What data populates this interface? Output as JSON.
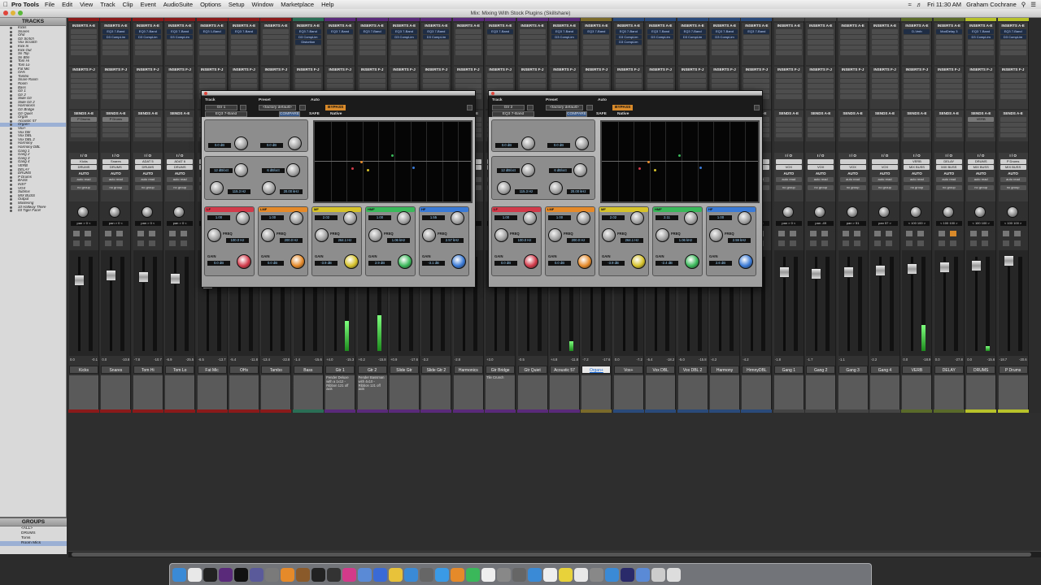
{
  "menubar": {
    "app": "Pro Tools",
    "items": [
      "File",
      "Edit",
      "View",
      "Track",
      "Clip",
      "Event",
      "AudioSuite",
      "Options",
      "Setup",
      "Window",
      "Marketplace",
      "Help"
    ],
    "time": "Fri 11:30 AM",
    "user": "Graham Cochrane"
  },
  "window": {
    "title": "Mix: Mixing With Stock Plugins (Skillshare)"
  },
  "tracks_panel": {
    "title": "TRACKS",
    "items": [
      "Kicks",
      "Snares",
      "Ohd",
      "Gtr Scrtch",
      "Vox Scratch",
      "Kick In",
      "Kick Out",
      "Sn Top",
      "Sn Btm",
      "Tom Hi",
      "Tom Lo",
      "Fat Mic",
      "OHs",
      "Tambo",
      "Snare Room",
      "Room",
      "Bass",
      "Gtr 1",
      "Gtr 2",
      "Slide Gtr",
      "Slide Gtr 2",
      "Harmonics",
      "Gtr Bridge",
      "Gtr Quiet",
      "Organ",
      "Acoustic 57",
      "Organ+",
      "Vox+",
      "Vox Dbl",
      "Vox DBL",
      "Vox DBL 2",
      "Harmony",
      "Harmony DBL",
      "Gang 1",
      "Gang 2",
      "Gang 3",
      "Gang 4",
      "VERB",
      "DELAY",
      "DRUMS",
      "P Drums",
      "BASS",
      "INST",
      "VOX",
      "Submix",
      "MIX BUSS",
      "Output",
      "Mastering",
      "10 Halfway There",
      "03 Tiger Face!"
    ],
    "selected": "Organ+"
  },
  "groups_panel": {
    "title": "GROUPS",
    "items": [
      "<ALL>",
      "DRUMS",
      "Toms",
      "Room Mics"
    ],
    "selected": "Room Mics"
  },
  "strip_labels": {
    "inserts_ae": "INSERTS A-E",
    "inserts_fj": "INSERTS F-J",
    "sends": "SENDS A-E",
    "io": "I / O",
    "auto": "AUTO",
    "group": "no group",
    "auto_mode": "auto read"
  },
  "strips": [
    {
      "name": "Kicks",
      "ins": [],
      "send": "P Drums",
      "out": "DRUMS",
      "in": "Kicks",
      "pan": "pan  > 0 <",
      "vol": [
        "0.0",
        "-0.1"
      ],
      "color": "#8a1a1a",
      "comment": ""
    },
    {
      "name": "Snares",
      "ins": [
        "EQ3 7-Band",
        "D3 CompLim"
      ],
      "send": "P Drums",
      "out": "DRUMS",
      "in": "Snares",
      "pan": "pan  > 0 <",
      "vol": [
        "0.0",
        "-10.8"
      ],
      "color": "#8a1a1a",
      "comment": ""
    },
    {
      "name": "Tom Hi",
      "ins": [
        "EQ3 7-Band",
        "D3 CompLim"
      ],
      "send": "",
      "out": "DRUMS",
      "in": "ADAT 5",
      "pan": "pan  > 0 <",
      "vol": [
        "-7.8",
        "-10.7"
      ],
      "color": "#8a1a1a",
      "comment": ""
    },
    {
      "name": "Tom Lo",
      "ins": [
        "EQ3 7-Band",
        "D3 CompLim"
      ],
      "send": "",
      "out": "DRUMS",
      "in": "ADAT 6",
      "pan": "pan  > 0 <",
      "vol": [
        "-6.9",
        "-25.5"
      ],
      "color": "#8a1a1a",
      "comment": ""
    },
    {
      "name": "Fat Mic",
      "ins": [
        "EQ3 1-Band"
      ],
      "send": "",
      "out": "DRUMS",
      "in": "ADAT 7",
      "pan": "pan  > 0 <",
      "vol": [
        "-6.5",
        "-13.7"
      ],
      "color": "#8a1a1a",
      "comment": ""
    },
    {
      "name": "OHs",
      "ins": [
        "EQ3 7-Band"
      ],
      "send": "",
      "out": "DRUMS",
      "in": "",
      "pan": "pan  > 0 <",
      "vol": [
        "-5.4",
        "-11.8"
      ],
      "color": "#8a1a1a",
      "comment": ""
    },
    {
      "name": "Tambo",
      "ins": [],
      "send": "",
      "out": "DRUMS",
      "in": "",
      "pan": "pan  > 0 <",
      "vol": [
        "-13.4",
        "-22.8"
      ],
      "color": "#8a1a1a",
      "comment": ""
    },
    {
      "name": "Bass",
      "ins": [
        "EQ3 7-Band",
        "D3 CompLim",
        "Distortion"
      ],
      "send": "",
      "out": "BASS",
      "in": "",
      "pan": "pan  > 0 <",
      "vol": [
        "-1.4",
        "-15.6"
      ],
      "color": "#2a6e55",
      "comment": ""
    },
    {
      "name": "Gtr 1",
      "ins": [
        "EQ3 7-Band"
      ],
      "send": "",
      "out": "INST",
      "in": "",
      "pan": "pan  > 0 <",
      "vol": [
        "+4.0",
        "-15.3"
      ],
      "color": "#5a2a7a",
      "comment": "Fender Deluxe with a 1x12 - Ribbon 121 off axis"
    },
    {
      "name": "Gtr 2",
      "ins": [
        "EQ3 7-Band"
      ],
      "send": "",
      "out": "INST",
      "in": "",
      "pan": "pan  > 0 <",
      "vol": [
        "+0.2",
        "-15.8"
      ],
      "color": "#5a2a7a",
      "comment": "Fender Bassman with 4x10 - Ribbon 121 off axis"
    },
    {
      "name": "Slide Gtr",
      "ins": [
        "EQ3 7-Band",
        "D3 CompLim"
      ],
      "send": "",
      "out": "INST",
      "in": "",
      "pan": "pan  > 0 <",
      "vol": [
        "+0.9",
        "-17.6"
      ],
      "color": "#5a2a7a",
      "comment": ""
    },
    {
      "name": "Slide Gtr 2",
      "ins": [
        "EQ3 7-Band",
        "D3 CompLim"
      ],
      "send": "",
      "out": "INST",
      "in": "",
      "pan": "pan  > 0 <",
      "vol": [
        "-3.2",
        ""
      ],
      "color": "#5a2a7a",
      "comment": ""
    },
    {
      "name": "Harmonics",
      "ins": [],
      "send": "",
      "out": "INST",
      "in": "",
      "pan": "pan  > 0 <",
      "vol": [
        "-2.8",
        ""
      ],
      "color": "#5a2a7a",
      "comment": ""
    },
    {
      "name": "Gtr Bridge",
      "ins": [
        "EQ3 7-Band"
      ],
      "send": "",
      "out": "INST",
      "in": "",
      "pan": "pan  > 0 <",
      "vol": [
        "+3.0",
        ""
      ],
      "color": "#5a2a7a",
      "comment": "Tile Crunch"
    },
    {
      "name": "Gtr Quiet",
      "ins": [],
      "send": "",
      "out": "INST",
      "in": "",
      "pan": "pan  > 0 <",
      "vol": [
        "-0.5",
        ""
      ],
      "color": "#5a2a7a",
      "comment": ""
    },
    {
      "name": "Acoustic 57",
      "ins": [
        "EQ3 7-Band",
        "D3 CompLim"
      ],
      "send": "",
      "out": "INST",
      "in": "",
      "pan": "pan  > 0 <",
      "vol": [
        "+4.8",
        "-11.8"
      ],
      "color": "#5a2a7a",
      "comment": ""
    },
    {
      "name": "Organ+",
      "ins": [
        "EQ3 7-Band"
      ],
      "send": "",
      "out": "INST",
      "in": "",
      "pan": "pan  > 0 <",
      "vol": [
        "-7.2",
        "-17.6"
      ],
      "color": "#7a6a2a",
      "comment": ""
    },
    {
      "name": "Vox+",
      "ins": [
        "EQ3 7-Band",
        "D3 CompLim",
        "D3 CompLim"
      ],
      "send": "",
      "out": "VOX",
      "in": "",
      "pan": "pan  > 0 <",
      "vol": [
        "0.0",
        "-7.2"
      ],
      "color": "#2a4a7a",
      "comment": ""
    },
    {
      "name": "Vox DBL",
      "ins": [
        "EQ3 7-Band",
        "D3 CompLim"
      ],
      "send": "",
      "out": "VOX",
      "in": "",
      "pan": "pan  > 0 <",
      "vol": [
        "-5.4",
        "-18.2"
      ],
      "color": "#2a4a7a",
      "comment": ""
    },
    {
      "name": "Vox DBL 2",
      "ins": [
        "EQ3 7-Band",
        "D3 CompLim"
      ],
      "send": "",
      "out": "VOX",
      "in": "",
      "pan": "pan  > 0 <",
      "vol": [
        "-5.0",
        "-15.8"
      ],
      "color": "#2a4a7a",
      "comment": ""
    },
    {
      "name": "Harmony",
      "ins": [
        "EQ3 7-Band",
        "D3 CompLim"
      ],
      "send": "",
      "out": "VOX",
      "in": "",
      "pan": "pan  > 0 <",
      "vol": [
        "-4.2",
        ""
      ],
      "color": "#2a4a7a",
      "comment": ""
    },
    {
      "name": "HrmnyDBL",
      "ins": [
        "EQ3 7-Band"
      ],
      "send": "",
      "out": "VOX",
      "in": "",
      "pan": "pan  > 0 <",
      "vol": [
        "-4.2",
        ""
      ],
      "color": "#2a4a7a",
      "comment": ""
    },
    {
      "name": "Gang 1",
      "ins": [],
      "send": "",
      "out": "VOX",
      "in": "",
      "pan": "pan  > 0 <",
      "vol": [
        "-1.8",
        ""
      ],
      "color": "#444",
      "comment": ""
    },
    {
      "name": "Gang 2",
      "ins": [],
      "send": "",
      "out": "VOX",
      "in": "",
      "pan": "pan  -49",
      "vol": [
        "-1.7",
        ""
      ],
      "color": "#444",
      "comment": ""
    },
    {
      "name": "Gang 3",
      "ins": [],
      "send": "",
      "out": "VOX",
      "in": "",
      "pan": "pan  > 51",
      "vol": [
        "-1.1",
        ""
      ],
      "color": "#444",
      "comment": ""
    },
    {
      "name": "Gang 4",
      "ins": [],
      "send": "",
      "out": "VOX",
      "in": "",
      "pan": "pan  57 >",
      "vol": [
        "-2.2",
        ""
      ],
      "color": "#444",
      "comment": ""
    },
    {
      "name": "VERB",
      "ins": [
        "D-Verb"
      ],
      "send": "",
      "out": "MIX BUSS",
      "in": "VERB",
      "pan": "< 100  100 >",
      "vol": [
        "0.0",
        "-18.9"
      ],
      "color": "#5a6a2a",
      "comment": ""
    },
    {
      "name": "DELAY",
      "ins": [
        "ModDelay 3"
      ],
      "send": "",
      "out": "MIX BUSS",
      "in": "DELAY",
      "pan": "< 100  100 >",
      "vol": [
        "0.0",
        "-27.8"
      ],
      "color": "#5a6a2a",
      "comment": ""
    },
    {
      "name": "DRUMS",
      "ins": [
        "EQ3 7-Band",
        "D3 CompLim"
      ],
      "send": "VERB",
      "out": "MIX BUSS",
      "in": "DRUMS",
      "pan": "< 100  100 >",
      "vol": [
        "0.0",
        "-15.6"
      ],
      "color": "#b8c22a",
      "comment": ""
    },
    {
      "name": "P Drums",
      "ins": [
        "EQ3 7-Band",
        "D3 CompLim"
      ],
      "send": "",
      "out": "MIX BUSS",
      "in": "P Drums",
      "pan": "< 100  100 >",
      "vol": [
        "-18.7",
        "-20.6"
      ],
      "color": "#b8c22a",
      "comment": ""
    }
  ],
  "plugins": [
    {
      "track_label": "Track",
      "preset_label": "Preset",
      "auto_label": "Auto",
      "track": "Gtr 1",
      "preset": "<factory default>",
      "plugin": "EQ3 7-Band",
      "compare": "COMPARE",
      "safe": "SAFE",
      "native": "Native",
      "bypass": "BYPASS",
      "input": "0.0 dB",
      "output": "0.0 dB",
      "hpf_q": "12 dB/oct",
      "hpf_freq": "115.3 Hz",
      "lpf_q": "6 dB/oct",
      "lpf_freq": "20.00 kHz",
      "bands": [
        {
          "name": "LF",
          "q": "1.00",
          "freq": "100.0 Hz",
          "gain": "0.0 dB",
          "color": "#d23a4a"
        },
        {
          "name": "LMF",
          "q": "1.00",
          "freq": "200.0 Hz",
          "gain": "0.0 dB",
          "color": "#e58a2a"
        },
        {
          "name": "MF",
          "q": "2.02",
          "freq": "264.1 Hz",
          "gain": "-3.9 dB",
          "color": "#d6c22a"
        },
        {
          "name": "HMF",
          "q": "1.00",
          "freq": "1.06 kHz",
          "gain": "2.9 dB",
          "color": "#3ab85a"
        },
        {
          "name": "HF",
          "q": "1.55",
          "freq": "2.57 kHz",
          "gain": "-3.1 dB",
          "color": "#3a7ad6"
        }
      ],
      "graph_ticks": [
        "20",
        "50",
        "100",
        "200",
        "500",
        "1k",
        "2k",
        "5k",
        "10k",
        "20k"
      ]
    },
    {
      "track_label": "Track",
      "preset_label": "Preset",
      "auto_label": "Auto",
      "track": "Gtr 2",
      "preset": "<factory default>",
      "plugin": "EQ3 7-Band",
      "compare": "COMPARE",
      "safe": "SAFE",
      "native": "Native",
      "bypass": "BYPASS",
      "input": "0.0 dB",
      "output": "0.0 dB",
      "hpf_q": "12 dB/oct",
      "hpf_freq": "115.3 Hz",
      "lpf_q": "6 dB/oct",
      "lpf_freq": "20.00 kHz",
      "bands": [
        {
          "name": "LF",
          "q": "1.00",
          "freq": "100.0 Hz",
          "gain": "0.0 dB",
          "color": "#d23a4a"
        },
        {
          "name": "LMF",
          "q": "1.00",
          "freq": "200.0 Hz",
          "gain": "0.0 dB",
          "color": "#e58a2a"
        },
        {
          "name": "MF",
          "q": "2.02",
          "freq": "264.1 Hz",
          "gain": "-3.9 dB",
          "color": "#d6c22a"
        },
        {
          "name": "HMF",
          "q": "2.11",
          "freq": "1.06 kHz",
          "gain": "-2.4 dB",
          "color": "#3ab85a"
        },
        {
          "name": "HF",
          "q": "1.00",
          "freq": "2.59 kHz",
          "gain": "2.6 dB",
          "color": "#3a7ad6"
        }
      ],
      "graph_ticks": [
        "20",
        "50",
        "100",
        "200",
        "500",
        "1k",
        "2k",
        "5k",
        "10k",
        "20k"
      ]
    }
  ],
  "dock": {
    "icons": [
      "finder-icon",
      "chrome-icon",
      "logic-icon",
      "cubase-icon",
      "fcp-icon",
      "motion-icon",
      "compressor-icon",
      "vlc-icon",
      "guitar-icon",
      "ilok-icon",
      "movie-icon",
      "itunes-icon",
      "preview-icon",
      "keynote-icon",
      "photos-icon",
      "mail-icon",
      "system-icon",
      "safari-icon",
      "pages-icon",
      "numbers-icon",
      "textedit-icon",
      "prefs-icon",
      "rocket-icon",
      "appstore-icon",
      "calendar-icon",
      "notes-icon",
      "chrome2-icon",
      "font-icon",
      "dropbox-icon",
      "protools-icon",
      "downloads-icon",
      "help-icon",
      "trash-icon"
    ]
  }
}
